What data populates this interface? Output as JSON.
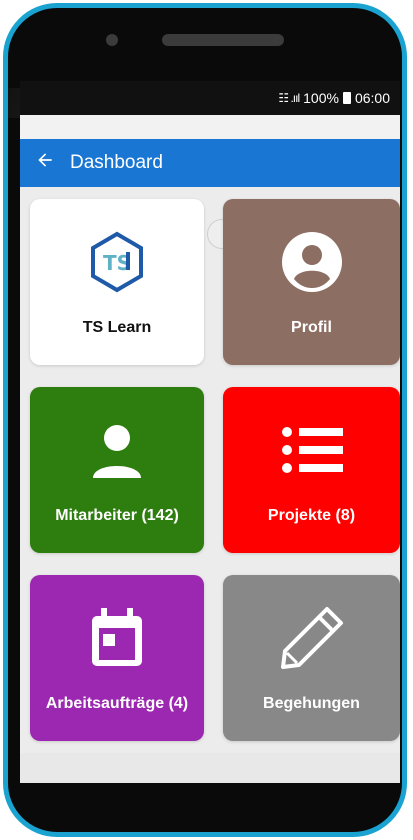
{
  "status_bar": {
    "signal": "☷ .ııl",
    "battery": "100%",
    "time": "06:00"
  },
  "app_bar": {
    "back_icon": "arrow-left-icon",
    "title": "Dashboard"
  },
  "tiles": [
    {
      "label": "TS Learn",
      "icon": "ts-learn-logo",
      "color": "#ffffff",
      "text_color": "#111111"
    },
    {
      "label": "Profil",
      "icon": "account-circle-icon",
      "color": "#8d6e63",
      "text_color": "#ffffff"
    },
    {
      "label": "Mitarbeiter (142)",
      "icon": "person-icon",
      "color": "#2e7d0f",
      "text_color": "#ffffff"
    },
    {
      "label": "Projekte (8)",
      "icon": "list-icon",
      "color": "#ff0000",
      "text_color": "#ffffff"
    },
    {
      "label": "Arbeitsaufträge (4)",
      "icon": "calendar-icon",
      "color": "#9c27b0",
      "text_color": "#ffffff"
    },
    {
      "label": "Begehungen",
      "icon": "pencil-icon",
      "color": "#888888",
      "text_color": "#ffffff"
    }
  ],
  "colors": {
    "app_bar": "#1976d2",
    "frame": "#1aa3d1"
  }
}
